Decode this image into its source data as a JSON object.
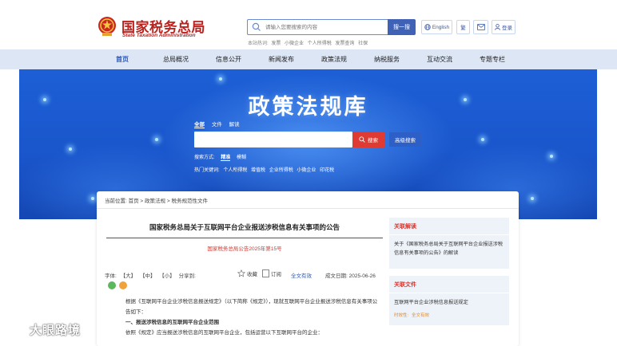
{
  "header": {
    "logo_cn": "国家税务总局",
    "logo_en": "State Taxation Administration",
    "search_placeholder": "请输入您要搜索的内容",
    "search_button": "搜一搜",
    "hot_title": "本站热词:",
    "hot_words": [
      "发票",
      "小微企业",
      "个人所得税",
      "发票查询",
      "社保"
    ],
    "english_label": "English",
    "traditional_label": "繁",
    "login_label": "登录"
  },
  "nav": {
    "items": [
      {
        "label": "首页",
        "active": true
      },
      {
        "label": "总局概况",
        "active": false
      },
      {
        "label": "信息公开",
        "active": false
      },
      {
        "label": "新闻发布",
        "active": false
      },
      {
        "label": "政策法规",
        "active": false
      },
      {
        "label": "纳税服务",
        "active": false
      },
      {
        "label": "互动交流",
        "active": false
      },
      {
        "label": "专题专栏",
        "active": false
      }
    ]
  },
  "banner": {
    "title": "政策法规库",
    "scope_tabs": [
      "全部",
      "文件",
      "解读"
    ],
    "search_button": "搜索",
    "advanced_button": "高级搜索",
    "mode_label": "搜索方式:",
    "modes": [
      "精准",
      "模糊"
    ],
    "hot_label": "热门关键词:",
    "hot_keywords": [
      "个人所得税",
      "增值税",
      "企业所得税",
      "小微企业",
      "印花税"
    ]
  },
  "breadcrumb": {
    "prefix": "当前位置:",
    "items": [
      "首页",
      "政策法规",
      "税务规范性文件"
    ],
    "separator": " > "
  },
  "document": {
    "title": "国家税务总局关于互联网平台企业报送涉税信息有关事项的公告",
    "number": "国家税务总局公告2025年第15号",
    "font_label": "字体:",
    "font_sizes": [
      "【大】",
      "【中】",
      "【小】"
    ],
    "share_label": "分享到:",
    "favorite_label": "收藏",
    "subscribe_label": "订阅",
    "validity": "全文有效",
    "date_label": "成文日期:",
    "date": "2025-06-26",
    "paragraphs": [
      "根据《互联网平台企业涉税信息报送规定》（以下简称《规定》），现就互联网平台企业报送涉税信息有关事项公告如下：",
      "一、报送涉税信息的互联网平台企业范围",
      "依照《规定》应当报送涉税信息的互联网平台企业，包括运营以下互联网平台的企业："
    ]
  },
  "sidebar": {
    "related_interpretation": {
      "heading": "关联解读",
      "text": "关于《国家税务总局关于互联网平台企业报送涉税信息有关事项的公告》的解读"
    },
    "related_file": {
      "heading": "关联文件",
      "text": "互联网平台企业涉税信息报送规定",
      "meta_label": "时效性:",
      "meta_value": "全文有效"
    }
  },
  "watermark": {
    "text": "大眼路境"
  },
  "colors": {
    "brand_red": "#b8231f",
    "nav_bg": "#dce6f5",
    "banner_blue": "#1a56cc",
    "search_red": "#e03b32",
    "link_blue": "#2b57b7"
  }
}
